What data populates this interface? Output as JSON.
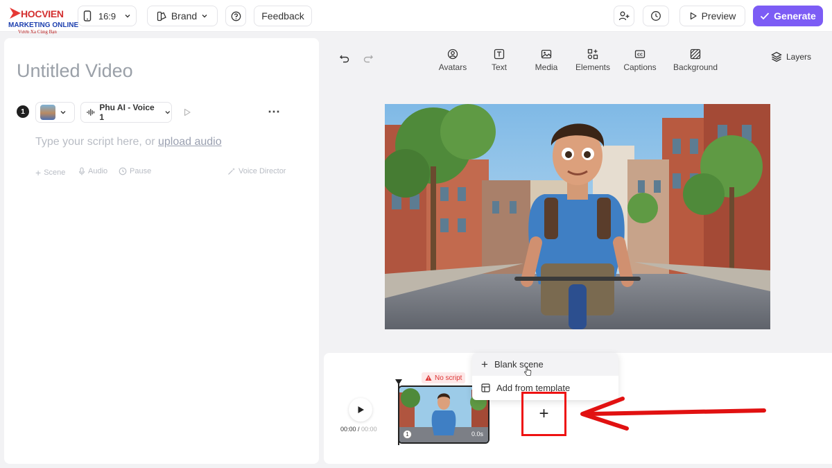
{
  "brand_logo": {
    "line1": "HOCVIEN",
    "line2": "MARKETING ONLINE",
    "line3": "Vươn Xa Cùng Bạn"
  },
  "topbar": {
    "aspect_ratio": "16:9",
    "brand_label": "Brand",
    "feedback_label": "Feedback",
    "preview_label": "Preview",
    "generate_label": "Generate"
  },
  "editor": {
    "title": "Untitled Video",
    "scene_number": "1",
    "voice_name": "Phu AI - Voice 1",
    "script_placeholder": "Type your script here, or",
    "upload_link": "upload audio",
    "options": {
      "scene": "Scene",
      "audio": "Audio",
      "pause": "Pause",
      "voice_director": "Voice Director"
    }
  },
  "toolbar": {
    "tools": [
      "Avatars",
      "Text",
      "Media",
      "Elements",
      "Captions",
      "Background"
    ],
    "layers": "Layers"
  },
  "timeline": {
    "time_current": "00:00",
    "time_total": "00:00",
    "warning": "No script",
    "thumb_number": "1",
    "thumb_duration": "0.0s",
    "menu": {
      "blank_scene": "Blank scene",
      "add_from_template": "Add from template"
    },
    "add_symbol": "+"
  },
  "colors": {
    "accent": "#7c5cf5",
    "annotation_red": "#e11111"
  }
}
